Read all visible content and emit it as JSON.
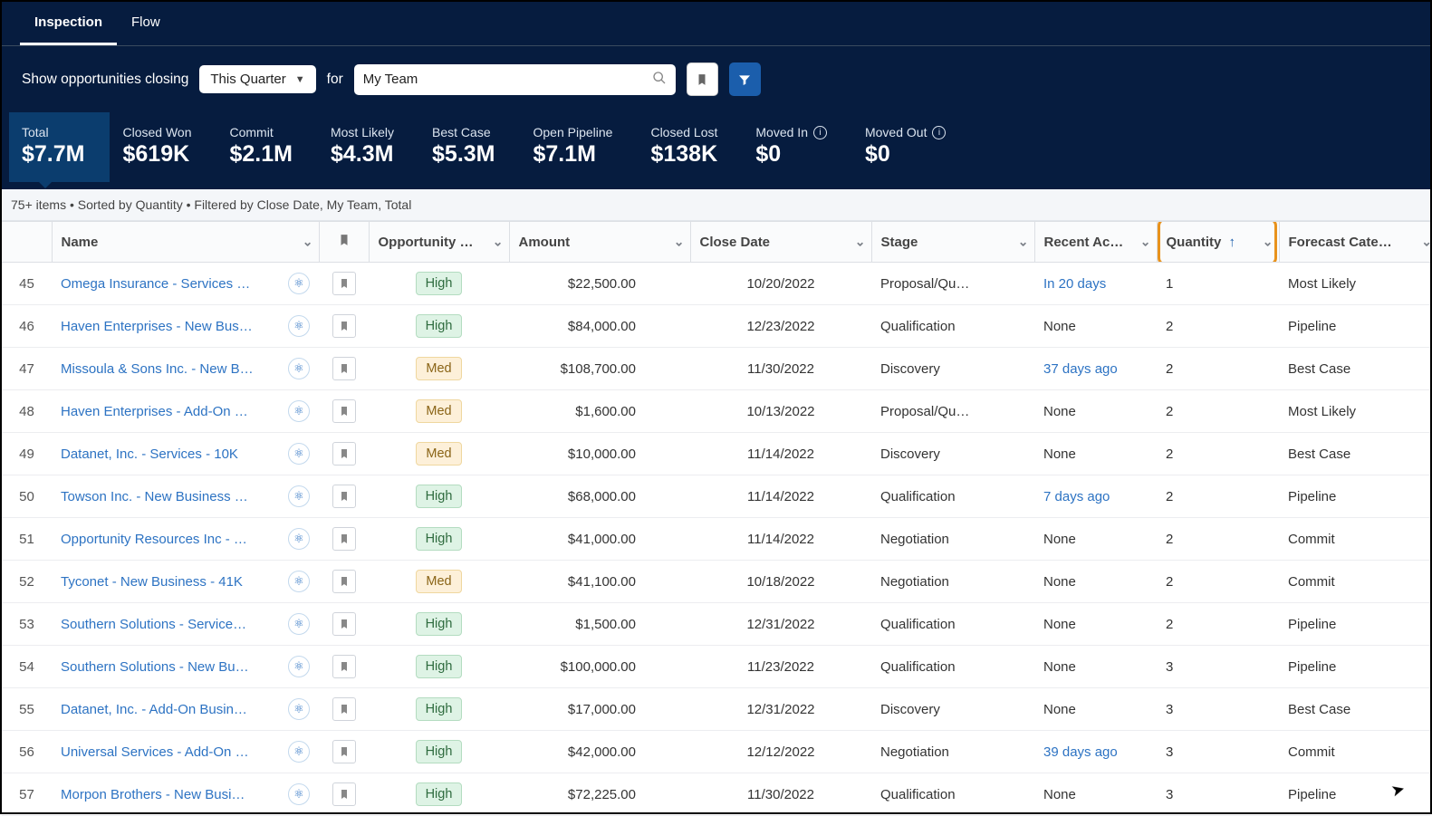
{
  "tabs": [
    {
      "label": "Inspection",
      "active": true
    },
    {
      "label": "Flow",
      "active": false
    }
  ],
  "filter": {
    "prefix": "Show opportunities closing",
    "period": "This Quarter",
    "for_label": "for",
    "team_value": "My Team"
  },
  "metrics": [
    {
      "label": "Total",
      "value": "$7.7M",
      "active": true,
      "info": false
    },
    {
      "label": "Closed Won",
      "value": "$619K",
      "active": false,
      "info": false
    },
    {
      "label": "Commit",
      "value": "$2.1M",
      "active": false,
      "info": false
    },
    {
      "label": "Most Likely",
      "value": "$4.3M",
      "active": false,
      "info": false
    },
    {
      "label": "Best Case",
      "value": "$5.3M",
      "active": false,
      "info": false
    },
    {
      "label": "Open Pipeline",
      "value": "$7.1M",
      "active": false,
      "info": false
    },
    {
      "label": "Closed Lost",
      "value": "$138K",
      "active": false,
      "info": false
    },
    {
      "label": "Moved In",
      "value": "$0",
      "active": false,
      "info": true
    },
    {
      "label": "Moved Out",
      "value": "$0",
      "active": false,
      "info": true
    }
  ],
  "list_meta": "75+ items • Sorted by Quantity • Filtered by Close Date, My Team, Total",
  "columns": {
    "name": "Name",
    "opportunity": "Opportunity …",
    "amount": "Amount",
    "close_date": "Close Date",
    "stage": "Stage",
    "recent": "Recent Ac…",
    "quantity": "Quantity",
    "forecast": "Forecast Cate…"
  },
  "rows": [
    {
      "idx": "45",
      "name": "Omega Insurance - Services …",
      "priority": "High",
      "amount": "$22,500.00",
      "close": "10/20/2022",
      "stage": "Proposal/Qu…",
      "recent": "In 20 days",
      "recent_link": true,
      "qty": "1",
      "forecast": "Most Likely"
    },
    {
      "idx": "46",
      "name": "Haven Enterprises - New Bus…",
      "priority": "High",
      "amount": "$84,000.00",
      "close": "12/23/2022",
      "stage": "Qualification",
      "recent": "None",
      "recent_link": false,
      "qty": "2",
      "forecast": "Pipeline"
    },
    {
      "idx": "47",
      "name": "Missoula & Sons Inc. - New B…",
      "priority": "Med",
      "amount": "$108,700.00",
      "close": "11/30/2022",
      "stage": "Discovery",
      "recent": "37 days ago",
      "recent_link": true,
      "qty": "2",
      "forecast": "Best Case"
    },
    {
      "idx": "48",
      "name": "Haven Enterprises - Add-On …",
      "priority": "Med",
      "amount": "$1,600.00",
      "close": "10/13/2022",
      "stage": "Proposal/Qu…",
      "recent": "None",
      "recent_link": false,
      "qty": "2",
      "forecast": "Most Likely"
    },
    {
      "idx": "49",
      "name": "Datanet, Inc. - Services - 10K",
      "priority": "Med",
      "amount": "$10,000.00",
      "close": "11/14/2022",
      "stage": "Discovery",
      "recent": "None",
      "recent_link": false,
      "qty": "2",
      "forecast": "Best Case"
    },
    {
      "idx": "50",
      "name": "Towson Inc. - New Business …",
      "priority": "High",
      "amount": "$68,000.00",
      "close": "11/14/2022",
      "stage": "Qualification",
      "recent": "7 days ago",
      "recent_link": true,
      "qty": "2",
      "forecast": "Pipeline"
    },
    {
      "idx": "51",
      "name": "Opportunity Resources Inc - …",
      "priority": "High",
      "amount": "$41,000.00",
      "close": "11/14/2022",
      "stage": "Negotiation",
      "recent": "None",
      "recent_link": false,
      "qty": "2",
      "forecast": "Commit"
    },
    {
      "idx": "52",
      "name": "Tyconet - New Business - 41K",
      "priority": "Med",
      "amount": "$41,100.00",
      "close": "10/18/2022",
      "stage": "Negotiation",
      "recent": "None",
      "recent_link": false,
      "qty": "2",
      "forecast": "Commit"
    },
    {
      "idx": "53",
      "name": "Southern Solutions - Service…",
      "priority": "High",
      "amount": "$1,500.00",
      "close": "12/31/2022",
      "stage": "Qualification",
      "recent": "None",
      "recent_link": false,
      "qty": "2",
      "forecast": "Pipeline"
    },
    {
      "idx": "54",
      "name": "Southern Solutions - New Bu…",
      "priority": "High",
      "amount": "$100,000.00",
      "close": "11/23/2022",
      "stage": "Qualification",
      "recent": "None",
      "recent_link": false,
      "qty": "3",
      "forecast": "Pipeline"
    },
    {
      "idx": "55",
      "name": "Datanet, Inc. - Add-On Busin…",
      "priority": "High",
      "amount": "$17,000.00",
      "close": "12/31/2022",
      "stage": "Discovery",
      "recent": "None",
      "recent_link": false,
      "qty": "3",
      "forecast": "Best Case"
    },
    {
      "idx": "56",
      "name": "Universal Services - Add-On …",
      "priority": "High",
      "amount": "$42,000.00",
      "close": "12/12/2022",
      "stage": "Negotiation",
      "recent": "39 days ago",
      "recent_link": true,
      "qty": "3",
      "forecast": "Commit"
    },
    {
      "idx": "57",
      "name": "Morpon Brothers - New Busi…",
      "priority": "High",
      "amount": "$72,225.00",
      "close": "11/30/2022",
      "stage": "Qualification",
      "recent": "None",
      "recent_link": false,
      "qty": "3",
      "forecast": "Pipeline"
    }
  ]
}
